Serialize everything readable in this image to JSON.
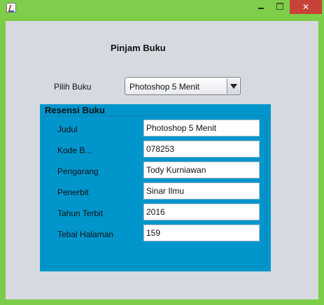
{
  "window": {
    "controls": {
      "minimize": "",
      "maximize": "",
      "close": "✕"
    }
  },
  "form": {
    "title": "Pinjam Buku",
    "pilih_label": "Pilih Buku",
    "selected_book": "Photoshop 5 Menit"
  },
  "panel": {
    "title": "Resensi Buku",
    "rows": [
      {
        "label": "Judul",
        "value": "Photoshop 5 Menit"
      },
      {
        "label": "Kode B...",
        "value": "078253"
      },
      {
        "label": "Pengarang",
        "value": "Tody Kurniawan"
      },
      {
        "label": "Penerbit",
        "value": "Sinar Ilmu"
      },
      {
        "label": "Tahun Terbit",
        "value": "2016"
      },
      {
        "label": "Tebal Halaman",
        "value": "159"
      }
    ]
  },
  "colors": {
    "titlebar": "#7fcd4a",
    "close_button": "#c7433a",
    "content_bg": "#d6d9e0",
    "panel_bg": "#0096cc"
  }
}
